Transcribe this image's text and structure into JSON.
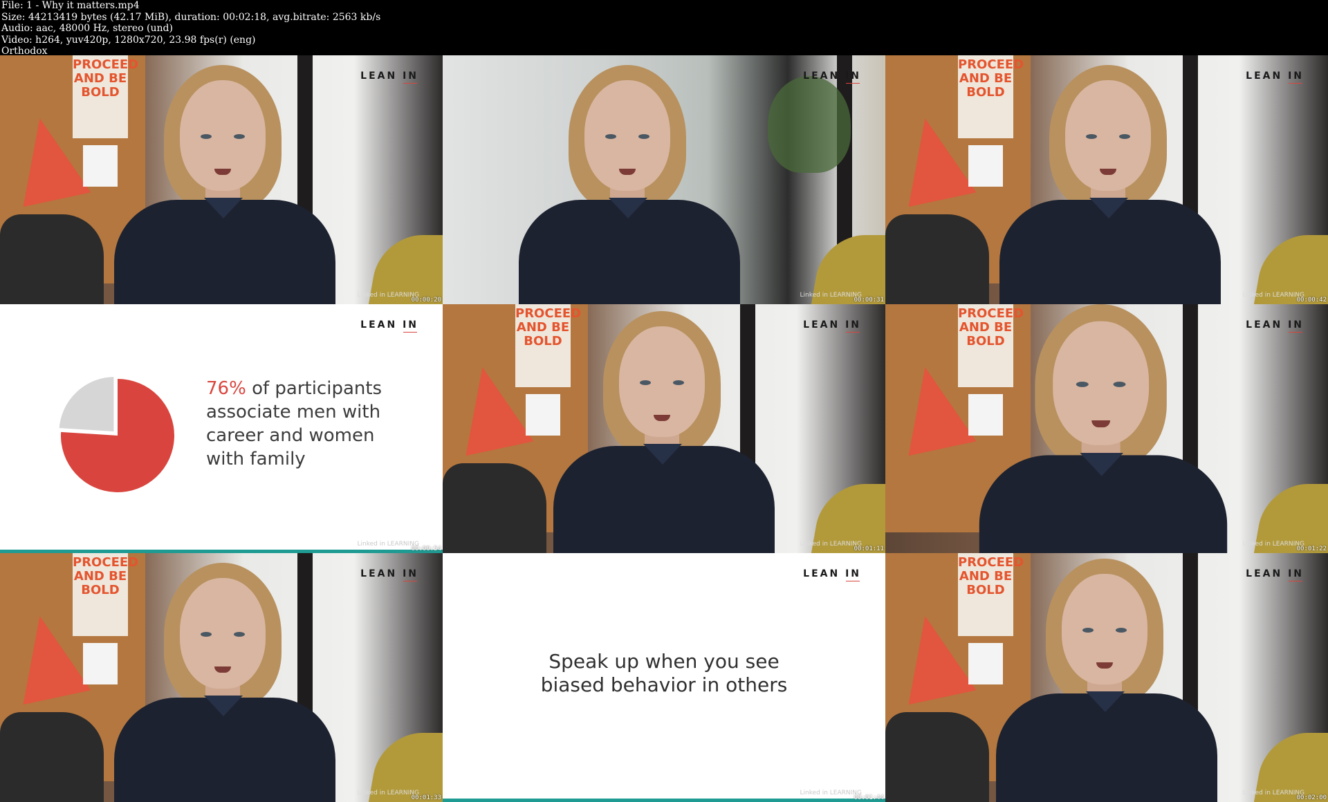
{
  "header": {
    "lines": [
      "File: 1 - Why it matters.mp4",
      "Size: 44213419 bytes (42.17 MiB), duration: 00:02:18, avg.bitrate: 2563 kb/s",
      "Audio: aac, 48000 Hz, stereo (und)",
      "Video: h264, yuv420p, 1280x720, 23.98 fps(r) (eng)",
      "Orthodox"
    ]
  },
  "brand": "LEAN IN",
  "watermark": "Linked in LEARNING",
  "poster_text": "PROCEED AND BE BOLD",
  "frames": [
    {
      "type": "speaker",
      "timestamp": "00:00:20"
    },
    {
      "type": "speaker",
      "timestamp": "00:00:31"
    },
    {
      "type": "speaker",
      "timestamp": "00:00:42"
    },
    {
      "type": "stat",
      "timestamp": "00:00:54",
      "pct": "76%",
      "text": "of participants associate men with career and women with family"
    },
    {
      "type": "speaker",
      "timestamp": "00:01:11"
    },
    {
      "type": "speaker",
      "timestamp": "00:01:22"
    },
    {
      "type": "speaker",
      "timestamp": "00:01:33"
    },
    {
      "type": "quote",
      "timestamp": "00:01:44",
      "text_line1": "Speak up when you see",
      "text_line2": "biased behavior in others"
    },
    {
      "type": "speaker",
      "timestamp": "00:02:00"
    }
  ],
  "pie": {
    "red_value": 76,
    "gray_value": 24,
    "red_color": "#d9453e",
    "gray_color": "#d6d6d6"
  }
}
